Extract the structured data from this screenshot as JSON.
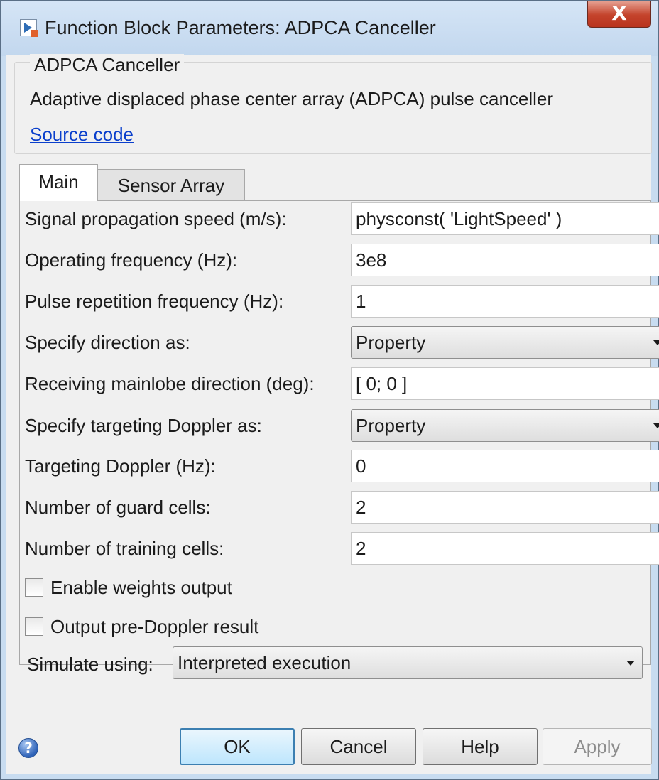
{
  "window": {
    "title": "Function Block Parameters: ADPCA Canceller",
    "close_glyph": "X"
  },
  "description": {
    "group_title": "ADPCA Canceller",
    "text": "Adaptive displaced phase center array (ADPCA) pulse canceller",
    "link_label": "Source code"
  },
  "tabs": [
    {
      "label": "Main",
      "active": true
    },
    {
      "label": "Sensor Array",
      "active": false
    }
  ],
  "params": {
    "signal_speed": {
      "label": "Signal propagation speed (m/s):",
      "value": "physconst( 'LightSpeed' )"
    },
    "op_freq": {
      "label": "Operating frequency (Hz):",
      "value": "3e8"
    },
    "prf": {
      "label": "Pulse repetition frequency (Hz):",
      "value": "1"
    },
    "direction_as": {
      "label": "Specify direction as:",
      "value": "Property"
    },
    "mainlobe_dir": {
      "label": "Receiving mainlobe direction (deg):",
      "value": "[ 0; 0 ]"
    },
    "doppler_as": {
      "label": "Specify targeting Doppler as:",
      "value": "Property"
    },
    "targeting_doppler": {
      "label": "Targeting Doppler (Hz):",
      "value": "0"
    },
    "guard_cells": {
      "label": "Number of guard cells:",
      "value": "2"
    },
    "training_cells": {
      "label": "Number of training cells:",
      "value": "2"
    }
  },
  "checkboxes": {
    "weights_output": {
      "label": "Enable weights output",
      "checked": false
    },
    "pre_doppler": {
      "label": "Output pre-Doppler result",
      "checked": false
    }
  },
  "simulate": {
    "label": "Simulate using:",
    "value": "Interpreted execution"
  },
  "buttons": {
    "ok": "OK",
    "cancel": "Cancel",
    "help": "Help",
    "apply": "Apply",
    "help_icon_glyph": "?"
  },
  "icons": {
    "app": "simulink-block-icon",
    "close": "close-icon",
    "help": "help-icon",
    "dropdown": "chevron-down-icon"
  }
}
